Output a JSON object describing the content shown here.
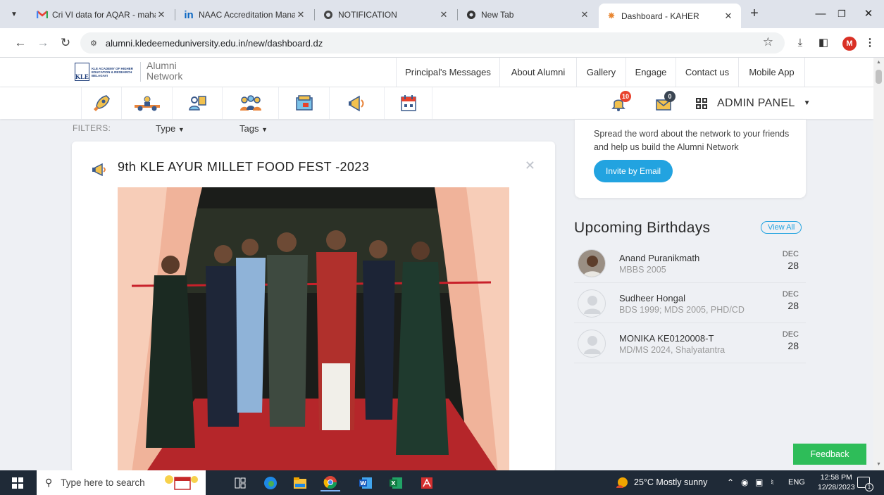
{
  "browser": {
    "tabs": [
      {
        "title": "Cri VI data for AQAR - maha",
        "icon": "gmail-icon"
      },
      {
        "title": "NAAC Accreditation Manage",
        "icon": "linkedin-icon"
      },
      {
        "title": "NOTIFICATION",
        "icon": "globe-icon"
      },
      {
        "title": "New Tab",
        "icon": "chrome-icon"
      },
      {
        "title": "Dashboard - KAHER",
        "icon": "site-icon",
        "active": true
      }
    ],
    "url": "alumni.kledeemeduniversity.edu.in/new/dashboard.dz",
    "profile_initial": "M"
  },
  "site": {
    "logo_text": "KLE ACADEMY OF HIGHER EDUCATION & RESEARCH BELAGAVI",
    "logo_mark": "KLE",
    "brand_line1": "Alumni",
    "brand_line2": "Network",
    "menu": [
      "Principal's Messages",
      "About Alumni",
      "Gallery",
      "Engage",
      "Contact us",
      "Mobile App"
    ],
    "notifications_count": "10",
    "messages_count": "0",
    "admin_panel_label": "ADMIN PANEL"
  },
  "filters": {
    "label": "FILTERS:",
    "type_label": "Type",
    "tags_label": "Tags"
  },
  "post": {
    "title": "9th KLE AYUR MILLET FOOD FEST -2023"
  },
  "invite": {
    "text": "Spread the word about the network to your friends and help us build the Alumni Network",
    "button_label": "Invite by Email"
  },
  "birthdays": {
    "title": "Upcoming Birthdays",
    "view_all_label": "View All",
    "items": [
      {
        "name": "Anand Puranikmath",
        "detail": "MBBS 2005",
        "month": "DEC",
        "day": "28"
      },
      {
        "name": "Sudheer Hongal",
        "detail": "BDS 1999; MDS 2005, PHD/CD",
        "month": "DEC",
        "day": "28"
      },
      {
        "name": "MONIKA KE0120008-T",
        "detail": "MD/MS 2024, Shalyatantra",
        "month": "DEC",
        "day": "28"
      }
    ]
  },
  "feedback_label": "Feedback",
  "taskbar": {
    "search_placeholder": "Type here to search",
    "weather": "25°C  Mostly sunny",
    "language": "ENG",
    "time": "12:58 PM",
    "date": "12/28/2023",
    "notification_count": "1"
  },
  "colors": {
    "accent": "#22a3e0",
    "feedback": "#2ebd59",
    "badge_red": "#e8422d",
    "taskbar": "#1f2a37"
  }
}
